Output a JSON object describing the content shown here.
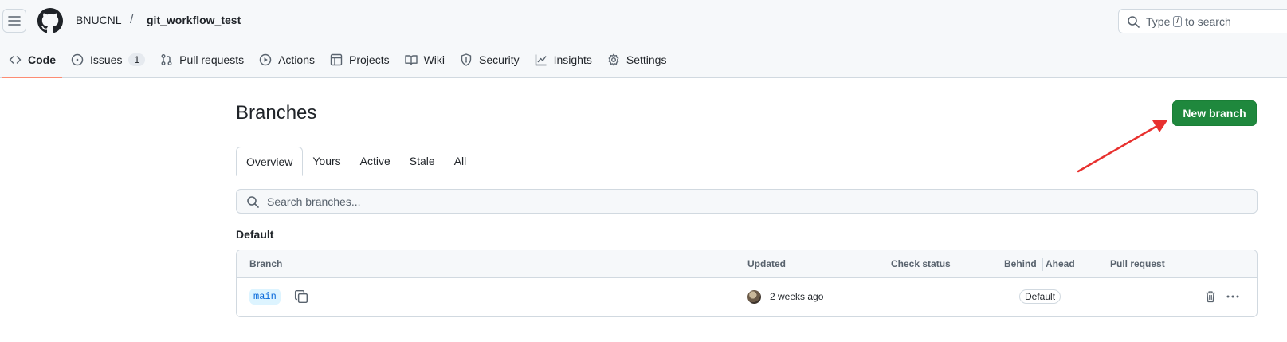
{
  "header": {
    "owner": "BNUCNL",
    "separator": "/",
    "repo": "git_workflow_test",
    "search_prefix": "Type",
    "search_key": "/",
    "search_suffix": "to search"
  },
  "nav": {
    "tabs": [
      {
        "label": "Code",
        "icon": "code-icon",
        "selected": true
      },
      {
        "label": "Issues",
        "icon": "issue-opened-icon",
        "counter": "1"
      },
      {
        "label": "Pull requests",
        "icon": "git-pull-request-icon"
      },
      {
        "label": "Actions",
        "icon": "play-icon"
      },
      {
        "label": "Projects",
        "icon": "table-icon"
      },
      {
        "label": "Wiki",
        "icon": "book-icon"
      },
      {
        "label": "Security",
        "icon": "shield-icon"
      },
      {
        "label": "Insights",
        "icon": "graph-icon"
      },
      {
        "label": "Settings",
        "icon": "gear-icon"
      }
    ]
  },
  "page": {
    "title": "Branches",
    "new_branch_label": "New branch",
    "subtabs": [
      "Overview",
      "Yours",
      "Active",
      "Stale",
      "All"
    ],
    "search_placeholder": "Search branches...",
    "section_title": "Default"
  },
  "table": {
    "columns": {
      "branch": "Branch",
      "updated": "Updated",
      "check_status": "Check status",
      "behind": "Behind",
      "ahead": "Ahead",
      "pull_request": "Pull request"
    },
    "rows": [
      {
        "branch": "main",
        "updated": "2 weeks ago",
        "badge": "Default"
      }
    ]
  },
  "colors": {
    "accent_green": "#1f883d",
    "tab_underline": "#fd8c73",
    "annotation_arrow": "#e8312f",
    "link_blue": "#0969da"
  }
}
